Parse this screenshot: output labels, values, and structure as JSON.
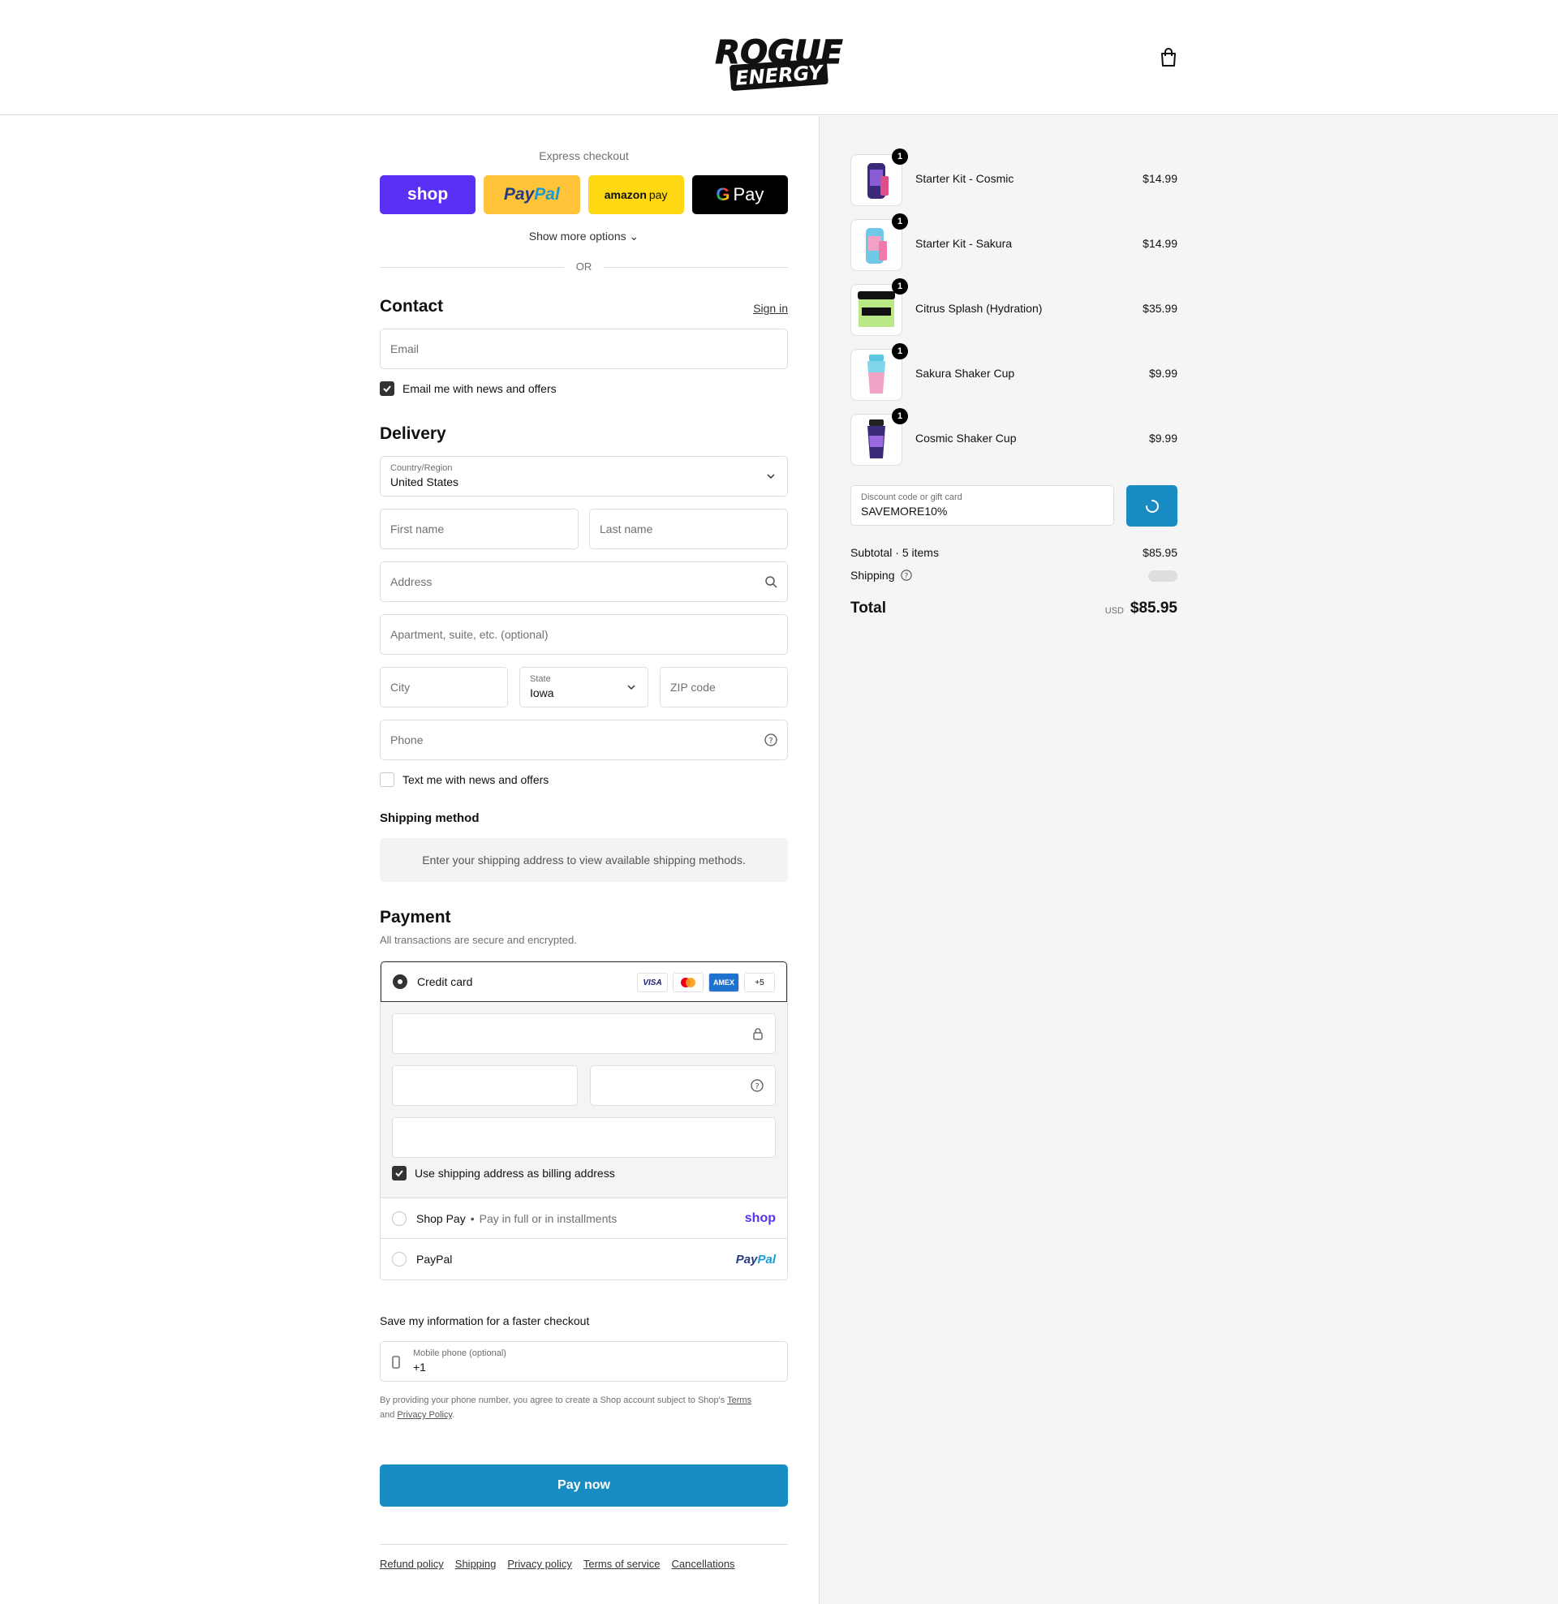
{
  "brand": {
    "name": "ROGUE ENERGY",
    "line1": "ROGUE",
    "line2": "ENERGY"
  },
  "express": {
    "title": "Express checkout",
    "buttons": {
      "shop": "shop",
      "paypal_a": "Pay",
      "paypal_b": "Pal",
      "amazon_a": "amazon",
      "amazon_b": "pay",
      "gpay_g": "G",
      "gpay": "Pay"
    },
    "more": "Show more options",
    "or": "OR"
  },
  "contact": {
    "title": "Contact",
    "sign_in": "Sign in",
    "email_placeholder": "Email",
    "email_news": "Email me with news and offers"
  },
  "delivery": {
    "title": "Delivery",
    "country_label": "Country/Region",
    "country_value": "United States",
    "first_name": "First name",
    "last_name": "Last name",
    "address": "Address",
    "apartment": "Apartment, suite, etc. (optional)",
    "city": "City",
    "state_label": "State",
    "state_value": "Iowa",
    "zip": "ZIP code",
    "phone": "Phone",
    "text_news": "Text me with news and offers"
  },
  "shipping_method": {
    "title": "Shipping method",
    "message": "Enter your shipping address to view available shipping methods."
  },
  "payment": {
    "title": "Payment",
    "subtitle": "All transactions are secure and encrypted.",
    "credit_card": "Credit card",
    "badges": {
      "visa": "VISA",
      "amex": "AMEX",
      "more": "+5"
    },
    "billing_same": "Use shipping address as billing address",
    "shop_pay": "Shop Pay",
    "shop_pay_sub": "Pay in full or in installments",
    "shop_logo": "shop",
    "paypal": "PayPal",
    "paypal_logo_a": "Pay",
    "paypal_logo_b": "Pal"
  },
  "save_info": {
    "title": "Save my information for a faster checkout",
    "mobile_label": "Mobile phone (optional)",
    "mobile_value": "+1",
    "legal_1": "By providing your phone number, you agree to create a Shop account subject to Shop's ",
    "terms": "Terms",
    "legal_2": "and ",
    "privacy": "Privacy Policy",
    "legal_3": "."
  },
  "pay_now": "Pay now",
  "footer": [
    "Refund policy",
    "Shipping",
    "Privacy policy",
    "Terms of service",
    "Cancellations"
  ],
  "order": {
    "items": [
      {
        "name": "Starter Kit - Cosmic",
        "price": "$14.99",
        "qty": "1"
      },
      {
        "name": "Starter Kit - Sakura",
        "price": "$14.99",
        "qty": "1"
      },
      {
        "name": "Citrus Splash (Hydration)",
        "price": "$35.99",
        "qty": "1"
      },
      {
        "name": "Sakura Shaker Cup",
        "price": "$9.99",
        "qty": "1"
      },
      {
        "name": "Cosmic Shaker Cup",
        "price": "$9.99",
        "qty": "1"
      }
    ],
    "discount_label": "Discount code or gift card",
    "discount_value": "SAVEMORE10%",
    "subtotal_label": "Subtotal · 5 items",
    "subtotal": "$85.95",
    "shipping_label": "Shipping",
    "total_label": "Total",
    "currency": "USD",
    "total": "$85.95"
  },
  "colors": {
    "accent": "#1a8cc4",
    "shop": "#5a31f4",
    "paypal": "#ffc439",
    "amazon": "#ffd814"
  }
}
